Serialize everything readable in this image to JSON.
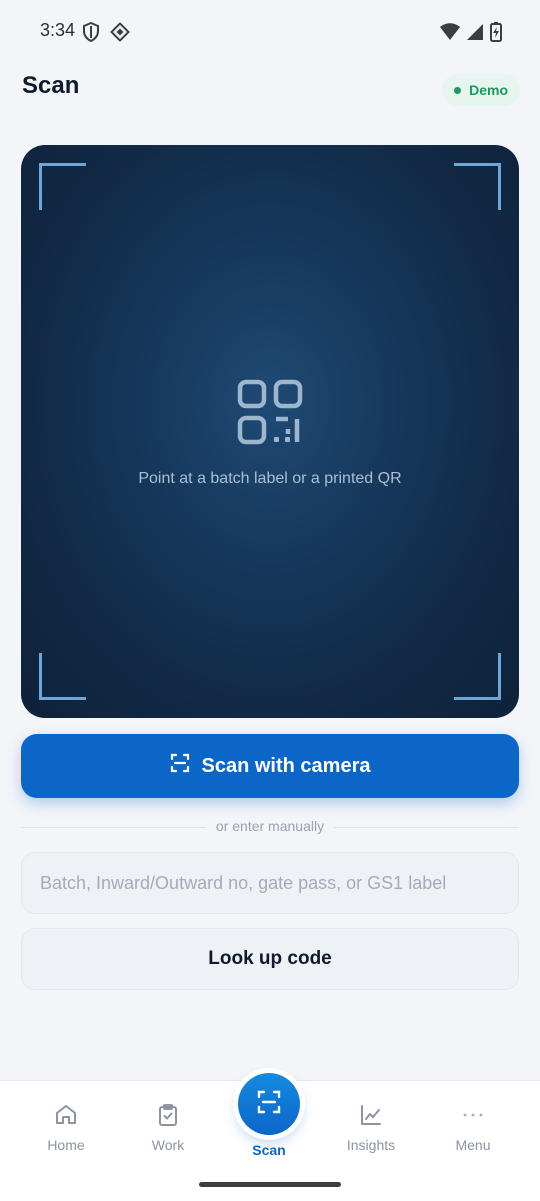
{
  "status_bar": {
    "time": "3:34",
    "left_icons": [
      "shield-icon",
      "location-diamond-icon"
    ],
    "right_icons": [
      "wifi-icon",
      "cell-signal-icon",
      "battery-icon"
    ]
  },
  "header": {
    "title": "Scan",
    "badge": "Demo",
    "badge_color": "#1c9a5a"
  },
  "scanner": {
    "icon": "qr-code-icon",
    "hint": "Point at a batch label or a printed QR"
  },
  "actions": {
    "scan_camera_label": "Scan with camera",
    "divider_text": "or enter manually",
    "input_placeholder": "Batch, Inward/Outward no, gate pass, or GS1 label",
    "input_value": "",
    "lookup_label": "Look up code",
    "accent": "#0b66c8"
  },
  "bottom_nav": {
    "items": [
      {
        "label": "Home",
        "icon": "home-icon"
      },
      {
        "label": "Work",
        "icon": "clipboard-check-icon"
      },
      {
        "label": "Scan",
        "icon": "scan-frame-icon",
        "active": true
      },
      {
        "label": "Insights",
        "icon": "line-chart-icon"
      },
      {
        "label": "Menu",
        "icon": "more-dots-icon"
      }
    ]
  }
}
